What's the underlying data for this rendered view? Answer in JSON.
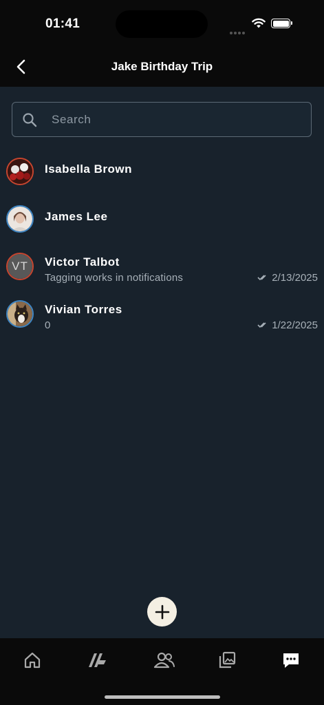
{
  "status_bar": {
    "time": "01:41"
  },
  "header": {
    "title": "Jake Birthday Trip"
  },
  "search": {
    "placeholder": "Search",
    "value": ""
  },
  "contacts": [
    {
      "name": "Isabella Brown",
      "preview": "",
      "date": "",
      "avatar": "roses-photo",
      "ring_color": "#c8452e"
    },
    {
      "name": "James Lee",
      "preview": "",
      "date": "",
      "avatar": "person-photo",
      "ring_color": "#3f86c4"
    },
    {
      "name": "Victor Talbot",
      "initials": "VT",
      "preview": "Tagging works in notifications",
      "date": "2/13/2025",
      "avatar": "initials",
      "ring_color": "#c8452e"
    },
    {
      "name": "Vivian Torres",
      "preview": "0",
      "date": "1/22/2025",
      "avatar": "cat-photo",
      "ring_color": "#3f86c4"
    }
  ],
  "tabs": [
    {
      "icon": "home-icon",
      "active": false
    },
    {
      "icon": "feed-icon",
      "active": false
    },
    {
      "icon": "people-icon",
      "active": false
    },
    {
      "icon": "gallery-icon",
      "active": false
    },
    {
      "icon": "chat-icon",
      "active": true
    }
  ],
  "colors": {
    "background": "#18222c",
    "bar": "#0a0a0a",
    "fab": "#f4efe3",
    "muted_text": "#a7b0b8"
  }
}
